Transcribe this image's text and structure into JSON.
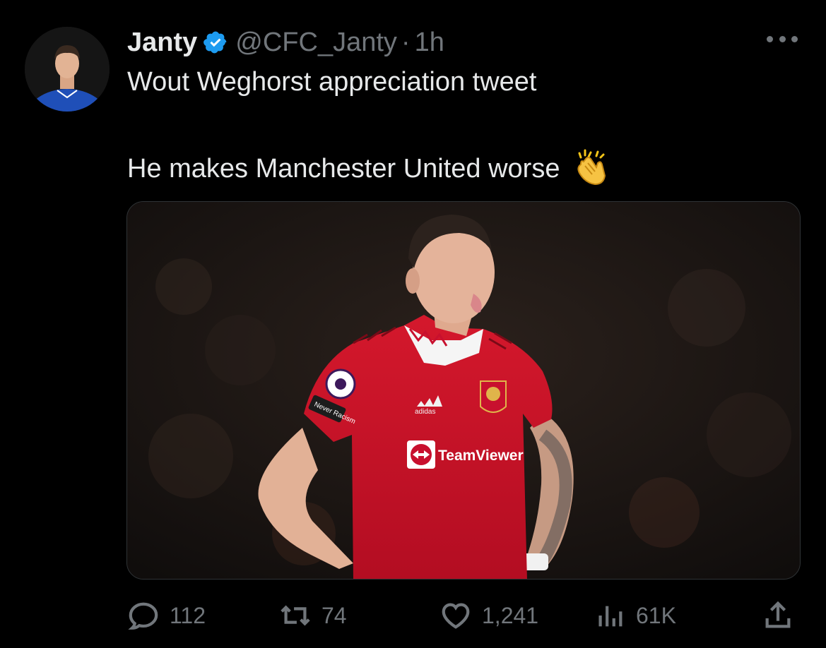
{
  "tweet": {
    "author": {
      "display_name": "Janty",
      "verified": true,
      "handle": "@CFC_Janty",
      "separator": "·",
      "time": "1h"
    },
    "text_line_1": "Wout Weghorst appreciation tweet",
    "text_line_2": "He makes Manchester United worse",
    "emoji": "clapping-hands",
    "media": {
      "kit_sponsor": "TeamViewer",
      "kit_brand": "adidas",
      "sleeve_text": "Never Racism"
    }
  },
  "actions": {
    "replies": "112",
    "retweets": "74",
    "likes": "1,241",
    "views": "61K"
  },
  "colors": {
    "background": "#000000",
    "text": "#e7e9ea",
    "muted": "#71767b",
    "verified": "#1d9bf0",
    "kit_red": "#c8102e"
  }
}
